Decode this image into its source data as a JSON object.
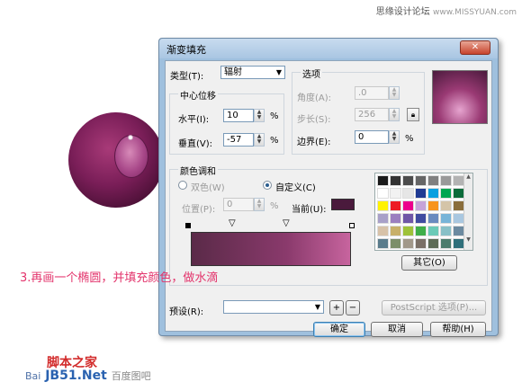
{
  "site_header": {
    "text": "思缘设计论坛",
    "url": "www.MISSYUAN.com"
  },
  "caption": "3.再画一个椭圆，并填充颜色，做水滴",
  "watermark": {
    "cn": "脚本之家",
    "site_net": "JB51.Net",
    "baidu": "Bai",
    "tail": "百度图吧"
  },
  "dialog": {
    "title": "渐变填充",
    "close_icon": "close-icon",
    "type_label": "类型(T):",
    "type_value": "辐射",
    "center_offset_label": "中心位移",
    "horizontal_label": "水平(I):",
    "horizontal_value": "10",
    "vertical_label": "垂直(V):",
    "vertical_value": "-57",
    "percent": "%",
    "options_label": "选项",
    "angle_label": "角度(A):",
    "angle_value": ".0",
    "steps_label": "步长(S):",
    "steps_value": "256",
    "edge_label": "边界(E):",
    "edge_value": "0",
    "blend_label": "颜色调和",
    "two_color_label": "双色(W)",
    "custom_label": "自定义(C)",
    "position_label": "位置(P):",
    "position_value": "0",
    "current_label": "当前(U):",
    "others_button": "其它(O)",
    "preset_label": "预设(R):",
    "postscript_button": "PostScript 选项(P)...",
    "ok_button": "确定",
    "cancel_button": "取消",
    "help_button": "帮助(H)"
  },
  "colors": {
    "current_swatch": "#4a1a3c",
    "gradient_start": "#5a2a48",
    "gradient_end": "#c7649e"
  }
}
